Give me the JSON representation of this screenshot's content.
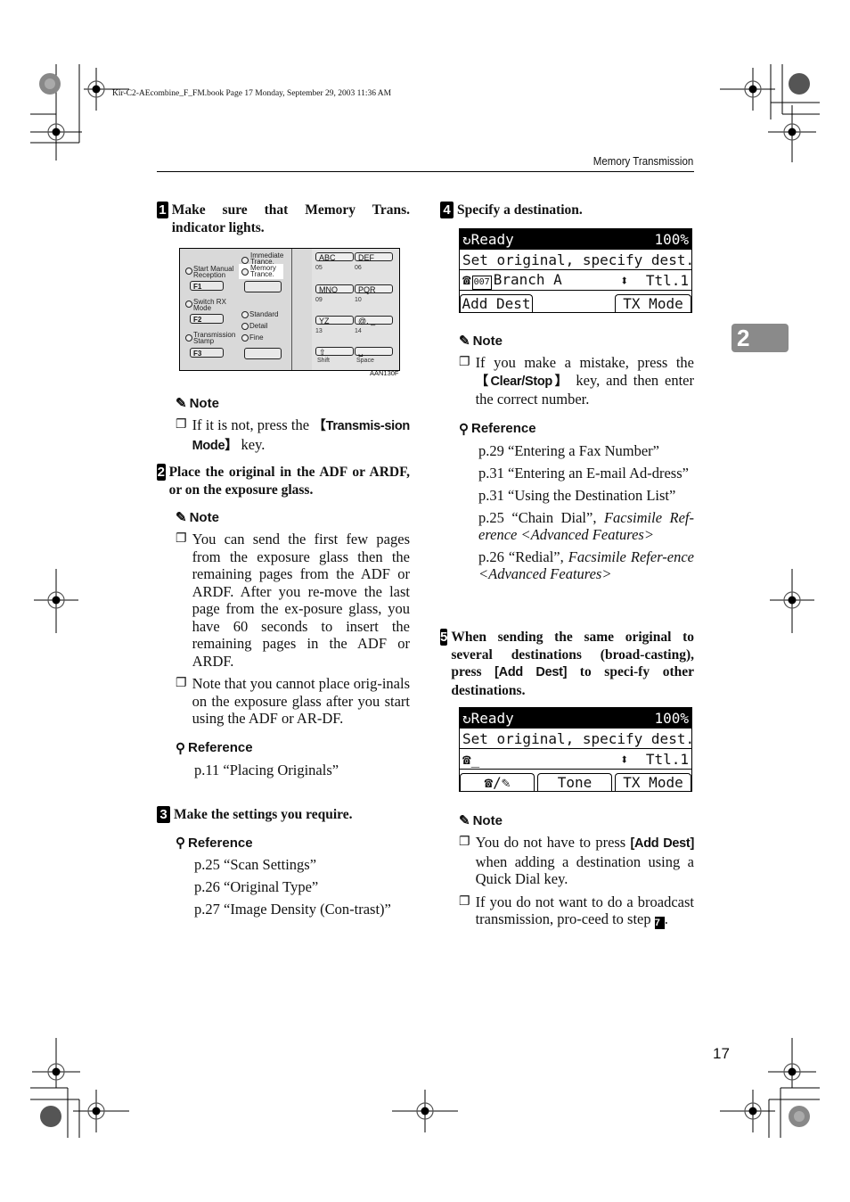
{
  "slug": "Kir-C2-AEcombine_F_FM.book  Page 17  Monday, September 29, 2003  11:36 AM",
  "running_head": "Memory Transmission",
  "chapter_tab": "2",
  "page_number": "17",
  "labels": {
    "note": "Note",
    "reference": "Reference"
  },
  "left": {
    "step1": {
      "num": "1",
      "text": "Make sure that Memory Trans. indicator lights."
    },
    "panel": {
      "figure_id": "AAN130F",
      "indicators": {
        "immediate": "Immediate Trance.",
        "memory": "Memory Trance.",
        "start_manual": "Start Manual Reception",
        "switch_rx": "Switch RX Mode",
        "tx_stamp": "Transmission Stamp",
        "standard": "Standard",
        "detail": "Detail",
        "fine": "Fine"
      },
      "fkeys": [
        "F1",
        "F2",
        "F3"
      ],
      "quick_keys": [
        "ABC",
        "DEF",
        "MNO",
        "PQR",
        "YZ",
        "@. _",
        "⇧",
        "␣"
      ],
      "quick_nums": [
        "05",
        "06",
        "09",
        "10",
        "13",
        "14"
      ],
      "bottom_labels": [
        "Shift",
        "Space"
      ]
    },
    "note1": {
      "pre": "If it is not, press the ",
      "key": "【Transmis-sion Mode】",
      "post": " key."
    },
    "step2": {
      "num": "2",
      "text": "Place the original in the ADF or ARDF, or on the exposure glass."
    },
    "note2": [
      "You can send the first few pages from the exposure glass then the remaining pages from the ADF or ARDF. After you re-move the last page from the ex-posure glass, you have 60 seconds to insert the remaining pages in the ADF or ARDF.",
      "Note that you cannot place orig-inals on the exposure glass after you start using the ADF or AR-DF."
    ],
    "ref2": [
      "p.11 “Placing Originals”"
    ],
    "step3": {
      "num": "3",
      "text": "Make the settings you require."
    },
    "ref3": [
      "p.25 “Scan Settings”",
      "p.26 “Original Type”",
      "p.27 “Image Density (Con-trast)”"
    ]
  },
  "right": {
    "step4": {
      "num": "4",
      "text": "Specify a destination."
    },
    "lcd1": {
      "status": "Ready",
      "zoom": "100%",
      "message": "Set original, specify dest.",
      "dest_num": "007",
      "dest_name": "Branch A",
      "total": "Ttl.1",
      "buttons": [
        "Add Dest",
        "TX Mode"
      ]
    },
    "note4": {
      "pre": "If you make a mistake, press the ",
      "key": "【Clear/Stop】",
      "post": " key, and then enter the correct number."
    },
    "ref4": [
      {
        "text": "p.29 “Entering a Fax Number”",
        "italic": ""
      },
      {
        "text": "p.31 “Entering an E-mail Ad-dress”",
        "italic": ""
      },
      {
        "text": "p.31 “Using the Destination List”",
        "italic": ""
      },
      {
        "text": "p.25 “Chain Dial”, ",
        "italic": "Facsimile Ref-erence <Advanced Features>"
      },
      {
        "text": "p.26 “Redial”, ",
        "italic": "Facsimile Refer-ence <Advanced Features>"
      }
    ],
    "step5": {
      "num": "5",
      "pre": "When sending the same original to several destinations (broad-casting), press ",
      "key": "[Add Dest]",
      "post": " to speci-fy other destinations."
    },
    "lcd2": {
      "status": "Ready",
      "zoom": "100%",
      "message": "Set original, specify dest.",
      "entry": "_",
      "total": "Ttl.1",
      "buttons": [
        "☎/✎",
        "Tone",
        "TX Mode"
      ]
    },
    "note5": [
      {
        "pre": "You do not have to press ",
        "key": "[Add Dest]",
        "post": " when adding a destination using a Quick Dial key."
      },
      {
        "pre": "If you do not want to do a broadcast transmission, pro-ceed to step ",
        "step": "7",
        "post": "."
      }
    ]
  }
}
